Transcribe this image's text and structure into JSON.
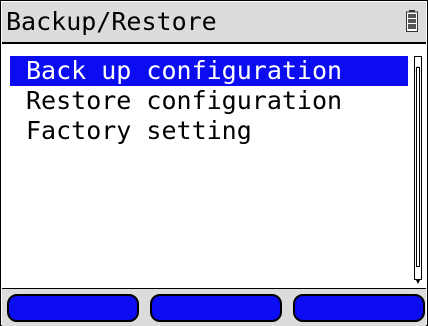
{
  "header": {
    "title": "Backup/Restore",
    "battery_icon": "battery-icon"
  },
  "menu": {
    "selected_index": 0,
    "items": [
      {
        "label": "Back up configuration"
      },
      {
        "label": "Restore configuration"
      },
      {
        "label": "Factory setting"
      }
    ]
  },
  "softkeys": [
    {
      "label": ""
    },
    {
      "label": ""
    },
    {
      "label": ""
    }
  ],
  "colors": {
    "selection": "#0c0cf0",
    "softkey": "#0c0cf0",
    "titlebar": "#dcdcdc"
  }
}
